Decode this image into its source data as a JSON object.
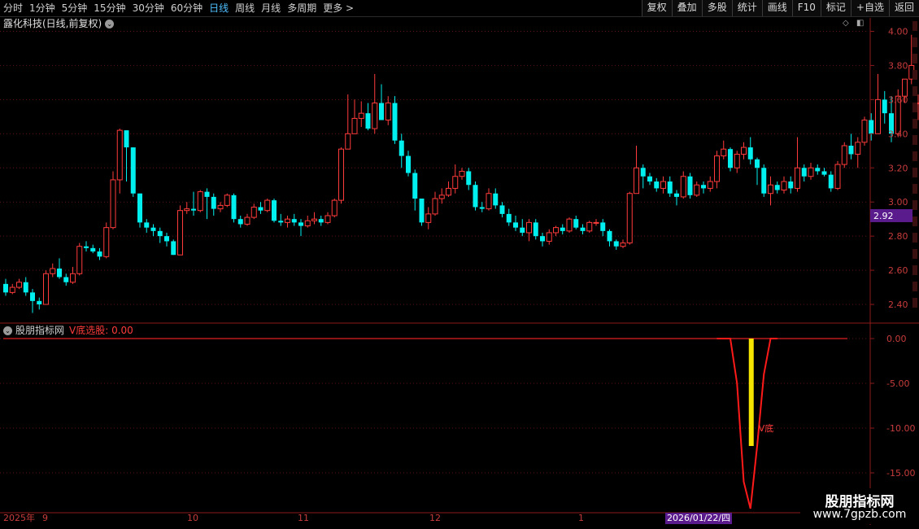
{
  "toolbar": {
    "periods": [
      "分时",
      "1分钟",
      "5分钟",
      "15分钟",
      "30分钟",
      "60分钟",
      "日线",
      "周线",
      "月线",
      "多周期",
      "更多 >"
    ],
    "active_period": "日线",
    "right_buttons": [
      "复权",
      "叠加",
      "多股",
      "统计",
      "画线",
      "F10",
      "标记",
      "+自选",
      "返回"
    ]
  },
  "main_chart": {
    "title": "露化科技(日线,前复权)",
    "y_ticks": [
      "4.00",
      "3.80",
      "3.60",
      "3.40",
      "3.20",
      "3.00",
      "2.80",
      "2.60",
      "2.40"
    ],
    "current_price_label": "2.92",
    "colors": {
      "up": "#ff3b3b",
      "down": "#00f0f0",
      "price_tag_bg": "#5a1c8c"
    }
  },
  "indicator": {
    "name": "股朋指标网",
    "value_label": "V底选股: 0.00",
    "y_ticks": [
      "0.00",
      "-5.00",
      "-10.00",
      "-15.00"
    ],
    "annotation": "V底"
  },
  "date_axis": {
    "labels": [
      "2025年",
      "9",
      "10",
      "11",
      "12",
      "1"
    ],
    "cursor_date": "2026/01/22/四"
  },
  "watermark": {
    "line1": "股朋指标网",
    "line2": "www.7gpzb.com"
  },
  "chart_data": {
    "type": "candlestick",
    "title": "露化科技(日线,前复权)",
    "ylim": [
      2.3,
      4.05
    ],
    "candles": [
      [
        2.52,
        2.47,
        2.55,
        2.45
      ],
      [
        2.47,
        2.5,
        2.52,
        2.46
      ],
      [
        2.5,
        2.53,
        2.55,
        2.49
      ],
      [
        2.53,
        2.47,
        2.56,
        2.45
      ],
      [
        2.47,
        2.42,
        2.49,
        2.35
      ],
      [
        2.42,
        2.4,
        2.44,
        2.37
      ],
      [
        2.4,
        2.58,
        2.6,
        2.4
      ],
      [
        2.58,
        2.61,
        2.64,
        2.56
      ],
      [
        2.61,
        2.56,
        2.67,
        2.55
      ],
      [
        2.56,
        2.53,
        2.58,
        2.51
      ],
      [
        2.53,
        2.58,
        2.62,
        2.52
      ],
      [
        2.58,
        2.74,
        2.76,
        2.57
      ],
      [
        2.74,
        2.73,
        2.77,
        2.71
      ],
      [
        2.73,
        2.71,
        2.75,
        2.7
      ],
      [
        2.71,
        2.68,
        2.73,
        2.66
      ],
      [
        2.68,
        2.85,
        2.88,
        2.67
      ],
      [
        2.85,
        3.13,
        3.18,
        2.84
      ],
      [
        3.13,
        3.42,
        3.43,
        3.05
      ],
      [
        3.42,
        3.32,
        3.35,
        3.12
      ],
      [
        3.32,
        3.05,
        3.13,
        3.03
      ],
      [
        3.05,
        2.88,
        2.98,
        2.85
      ],
      [
        2.88,
        2.85,
        2.9,
        2.82
      ],
      [
        2.85,
        2.83,
        2.87,
        2.8
      ],
      [
        2.83,
        2.8,
        2.85,
        2.76
      ],
      [
        2.8,
        2.77,
        2.82,
        2.74
      ],
      [
        2.77,
        2.69,
        2.78,
        2.69
      ],
      [
        2.69,
        2.95,
        2.98,
        2.69
      ],
      [
        2.95,
        2.96,
        3.0,
        2.93
      ],
      [
        2.96,
        2.95,
        3.06,
        2.92
      ],
      [
        2.95,
        3.06,
        3.07,
        2.94
      ],
      [
        3.06,
        3.03,
        3.08,
        2.9
      ],
      [
        3.03,
        2.96,
        3.05,
        2.92
      ],
      [
        2.96,
        2.98,
        3.0,
        2.94
      ],
      [
        2.98,
        3.04,
        3.05,
        2.97
      ],
      [
        3.04,
        2.9,
        3.05,
        2.88
      ],
      [
        2.9,
        2.87,
        2.92,
        2.85
      ],
      [
        2.87,
        2.91,
        2.93,
        2.86
      ],
      [
        2.91,
        2.97,
        2.99,
        2.9
      ],
      [
        2.97,
        2.95,
        3.0,
        2.93
      ],
      [
        2.95,
        3.01,
        3.02,
        2.94
      ],
      [
        3.01,
        2.89,
        3.02,
        2.88
      ],
      [
        2.89,
        2.88,
        2.93,
        2.86
      ],
      [
        2.88,
        2.9,
        2.92,
        2.85
      ],
      [
        2.9,
        2.88,
        2.93,
        2.86
      ],
      [
        2.88,
        2.86,
        2.9,
        2.8
      ],
      [
        2.86,
        2.89,
        2.92,
        2.85
      ],
      [
        2.89,
        2.9,
        2.94,
        2.87
      ],
      [
        2.9,
        2.88,
        2.92,
        2.86
      ],
      [
        2.88,
        2.92,
        2.94,
        2.87
      ],
      [
        2.92,
        3.01,
        3.02,
        2.91
      ],
      [
        3.01,
        3.31,
        3.32,
        2.99
      ],
      [
        3.31,
        3.4,
        3.63,
        3.35
      ],
      [
        3.4,
        3.49,
        3.6,
        3.45
      ],
      [
        3.49,
        3.52,
        3.59,
        3.44
      ],
      [
        3.52,
        3.43,
        3.58,
        3.42
      ],
      [
        3.43,
        3.58,
        3.75,
        3.4
      ],
      [
        3.58,
        3.48,
        3.69,
        3.48
      ],
      [
        3.48,
        3.58,
        3.62,
        3.45
      ],
      [
        3.58,
        3.36,
        3.62,
        3.34
      ],
      [
        3.36,
        3.27,
        3.4,
        3.2
      ],
      [
        3.27,
        3.17,
        3.3,
        3.15
      ],
      [
        3.17,
        3.02,
        3.19,
        2.95
      ],
      [
        3.02,
        2.88,
        3.02,
        2.86
      ],
      [
        2.88,
        2.93,
        2.97,
        2.84
      ],
      [
        2.93,
        3.02,
        3.06,
        2.92
      ],
      [
        3.02,
        3.04,
        3.08,
        2.99
      ],
      [
        3.04,
        3.08,
        3.12,
        3.03
      ],
      [
        3.08,
        3.15,
        3.22,
        3.05
      ],
      [
        3.15,
        3.18,
        3.2,
        3.13
      ],
      [
        3.18,
        3.1,
        3.2,
        3.07
      ],
      [
        3.1,
        2.97,
        3.12,
        2.95
      ],
      [
        2.97,
        2.96,
        3.0,
        2.94
      ],
      [
        2.96,
        3.05,
        3.08,
        2.95
      ],
      [
        3.05,
        2.98,
        3.08,
        2.96
      ],
      [
        2.98,
        2.93,
        3.0,
        2.91
      ],
      [
        2.93,
        2.88,
        2.96,
        2.86
      ],
      [
        2.88,
        2.85,
        2.92,
        2.83
      ],
      [
        2.85,
        2.82,
        2.9,
        2.8
      ],
      [
        2.82,
        2.88,
        2.9,
        2.77
      ],
      [
        2.88,
        2.8,
        2.9,
        2.78
      ],
      [
        2.8,
        2.77,
        2.82,
        2.74
      ],
      [
        2.77,
        2.82,
        2.84,
        2.75
      ],
      [
        2.82,
        2.85,
        2.86,
        2.8
      ],
      [
        2.85,
        2.83,
        2.87,
        2.81
      ],
      [
        2.83,
        2.9,
        2.91,
        2.82
      ],
      [
        2.9,
        2.85,
        2.92,
        2.84
      ],
      [
        2.85,
        2.83,
        2.87,
        2.81
      ],
      [
        2.83,
        2.88,
        2.89,
        2.82
      ],
      [
        2.88,
        2.88,
        2.9,
        2.86
      ],
      [
        2.88,
        2.83,
        2.9,
        2.8
      ],
      [
        2.83,
        2.77,
        2.84,
        2.74
      ],
      [
        2.77,
        2.74,
        2.78,
        2.72
      ],
      [
        2.74,
        2.76,
        2.78,
        2.73
      ],
      [
        2.76,
        3.05,
        3.06,
        2.75
      ],
      [
        3.05,
        3.2,
        3.33,
        3.1
      ],
      [
        3.2,
        3.15,
        3.22,
        3.08
      ],
      [
        3.15,
        3.12,
        3.17,
        3.1
      ],
      [
        3.12,
        3.08,
        3.14,
        3.06
      ],
      [
        3.08,
        3.12,
        3.15,
        3.05
      ],
      [
        3.12,
        3.05,
        3.15,
        3.03
      ],
      [
        3.05,
        3.03,
        3.07,
        2.98
      ],
      [
        3.03,
        3.15,
        3.18,
        3.02
      ],
      [
        3.15,
        3.04,
        3.17,
        3.02
      ],
      [
        3.04,
        3.1,
        3.12,
        3.03
      ],
      [
        3.1,
        3.08,
        3.12,
        3.05
      ],
      [
        3.08,
        3.12,
        3.15,
        3.06
      ],
      [
        3.12,
        3.27,
        3.3,
        3.08
      ],
      [
        3.27,
        3.31,
        3.36,
        3.25
      ],
      [
        3.31,
        3.2,
        3.32,
        3.18
      ],
      [
        3.2,
        3.28,
        3.3,
        3.17
      ],
      [
        3.28,
        3.32,
        3.35,
        3.25
      ],
      [
        3.32,
        3.25,
        3.38,
        3.22
      ],
      [
        3.25,
        3.2,
        3.26,
        3.1
      ],
      [
        3.2,
        3.05,
        3.22,
        3.03
      ],
      [
        3.05,
        3.1,
        3.15,
        2.98
      ],
      [
        3.1,
        3.07,
        3.12,
        3.05
      ],
      [
        3.07,
        3.12,
        3.15,
        3.05
      ],
      [
        3.12,
        3.08,
        3.15,
        3.05
      ],
      [
        3.08,
        3.2,
        3.38,
        3.06
      ],
      [
        3.2,
        3.15,
        3.22,
        3.12
      ],
      [
        3.15,
        3.2,
        3.23,
        3.13
      ],
      [
        3.2,
        3.18,
        3.22,
        3.16
      ],
      [
        3.18,
        3.16,
        3.2,
        3.15
      ],
      [
        3.16,
        3.08,
        3.18,
        3.06
      ],
      [
        3.08,
        3.22,
        3.24,
        3.07
      ],
      [
        3.22,
        3.33,
        3.35,
        3.2
      ],
      [
        3.33,
        3.28,
        3.4,
        3.25
      ],
      [
        3.28,
        3.35,
        3.38,
        3.2
      ],
      [
        3.35,
        3.48,
        3.5,
        3.33
      ],
      [
        3.48,
        3.4,
        3.52,
        3.36
      ],
      [
        3.4,
        3.6,
        3.75,
        3.4
      ],
      [
        3.6,
        3.52,
        3.65,
        3.46
      ],
      [
        3.52,
        3.4,
        3.62,
        3.35
      ],
      [
        3.4,
        3.62,
        3.66,
        3.38
      ],
      [
        3.62,
        3.72,
        3.7,
        3.58
      ],
      [
        3.72,
        3.8,
        3.98,
        3.69
      ],
      [
        3.58,
        3.58,
        3.63,
        3.48
      ],
      [
        3.52,
        3.44,
        3.56,
        3.42
      ]
    ],
    "v_bottom_series": {
      "ylim": [
        -19.0,
        0.5
      ],
      "start_index": 106,
      "values": [
        0.0,
        0.0,
        0.0,
        -5.0,
        -16.0,
        -19.0,
        -12.0,
        -4.0,
        0.0,
        0.0
      ]
    }
  }
}
